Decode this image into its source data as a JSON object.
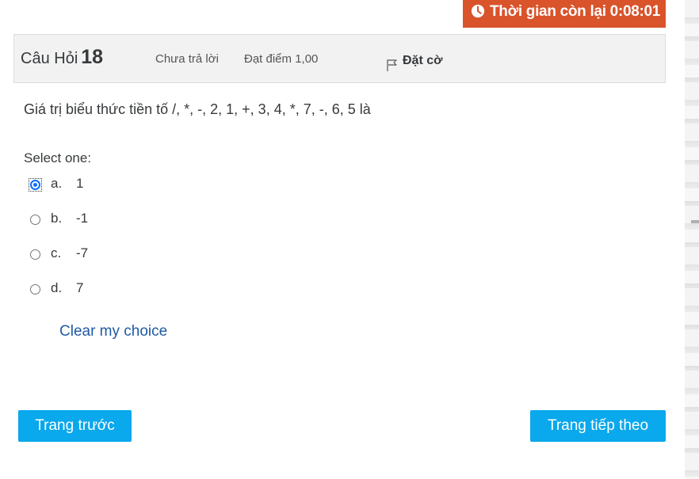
{
  "timer": {
    "label": "Thời gian còn lại 0:08:01",
    "icon": "clock-icon"
  },
  "question": {
    "prefix": "Câu Hỏi",
    "number": "18",
    "state": "Chưa trả lời",
    "grade": "Đạt điểm 1,00",
    "flag_label": "Đặt cờ",
    "text": "Giá trị biểu thức tiền tố /, *, -, 2, 1, +, 3, 4, *, 7, -, 6, 5 là"
  },
  "prompt": "Select one:",
  "answers": [
    {
      "letter": "a.",
      "value": "1",
      "checked": true
    },
    {
      "letter": "b.",
      "value": "-1",
      "checked": false
    },
    {
      "letter": "c.",
      "value": "-7",
      "checked": false
    },
    {
      "letter": "d.",
      "value": "7",
      "checked": false
    }
  ],
  "clear_label": "Clear my choice",
  "nav": {
    "prev_label": "Trang trước",
    "next_label": "Trang tiếp theo"
  },
  "colors": {
    "timer_bg": "#d9532b",
    "button_bg": "#0aa8ec",
    "link": "#1f5aa6",
    "radio_checked": "#0d6efd"
  }
}
